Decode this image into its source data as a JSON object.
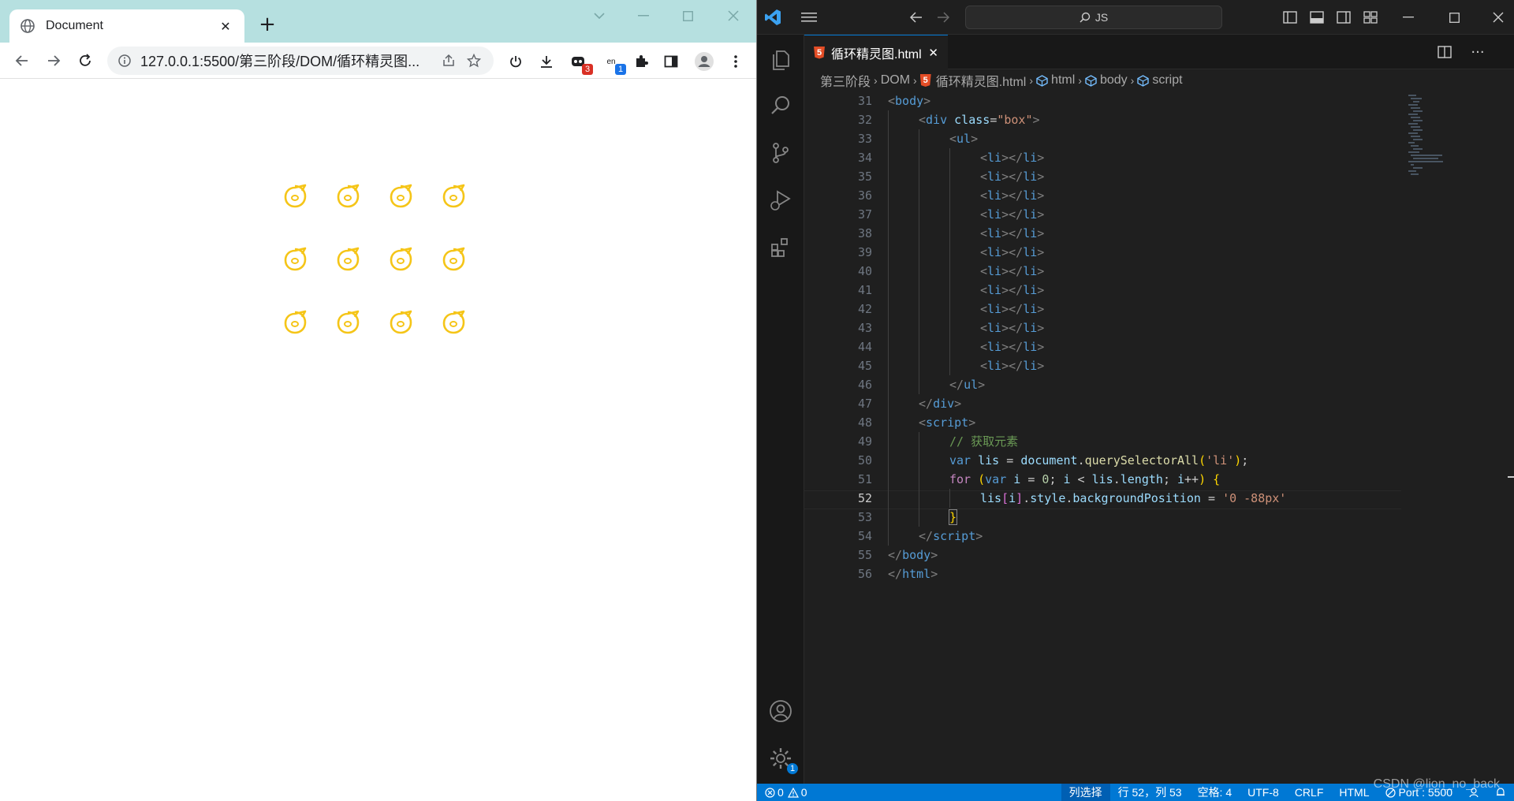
{
  "browser": {
    "tab": {
      "title": "Document"
    },
    "address": {
      "url": "127.0.0.1:5500/第三阶段/DOM/循环精灵图..."
    },
    "extensions": [
      {
        "name": "power-icon",
        "badge": ""
      },
      {
        "name": "download-icon",
        "badge": ""
      },
      {
        "name": "devtools-extension-icon",
        "badge": "3",
        "badge_color": "#d93025"
      },
      {
        "name": "translate-extension-icon",
        "badge": "1",
        "badge_color": "#1a73e8",
        "label": "en"
      },
      {
        "name": "puzzle-icon",
        "badge": ""
      },
      {
        "name": "side-panel-icon",
        "badge": ""
      },
      {
        "name": "profile-avatar-icon",
        "badge": ""
      },
      {
        "name": "kebab-menu-icon",
        "badge": ""
      }
    ],
    "sprites": {
      "rows": 3,
      "cols": 4,
      "color": "#f5c518"
    }
  },
  "vscode": {
    "search": {
      "text": "JS"
    },
    "editor_tab": {
      "filename": "循环精灵图.html"
    },
    "breadcrumb": [
      {
        "label": "第三阶段",
        "icon": ""
      },
      {
        "label": "DOM",
        "icon": ""
      },
      {
        "label": "循环精灵图.html",
        "icon": "html5"
      },
      {
        "label": "html",
        "icon": "cube"
      },
      {
        "label": "body",
        "icon": "cube"
      },
      {
        "label": "script",
        "icon": "cube"
      }
    ],
    "active_line": 52,
    "lines": [
      {
        "n": 31,
        "indent": 0,
        "html": "<span class=\"punct\">&lt;</span><span class=\"tag\">body</span><span class=\"punct\">&gt;</span>"
      },
      {
        "n": 32,
        "indent": 1,
        "html": "<span class=\"punct\">&lt;</span><span class=\"tag\">div</span> <span class=\"attr\">class</span>=<span class=\"str\">\"box\"</span><span class=\"punct\">&gt;</span>"
      },
      {
        "n": 33,
        "indent": 2,
        "html": "<span class=\"punct\">&lt;</span><span class=\"tag\">ul</span><span class=\"punct\">&gt;</span>"
      },
      {
        "n": 34,
        "indent": 3,
        "html": "<span class=\"punct\">&lt;</span><span class=\"tag\">li</span><span class=\"punct\">&gt;&lt;/</span><span class=\"tag\">li</span><span class=\"punct\">&gt;</span>"
      },
      {
        "n": 35,
        "indent": 3,
        "html": "<span class=\"punct\">&lt;</span><span class=\"tag\">li</span><span class=\"punct\">&gt;&lt;/</span><span class=\"tag\">li</span><span class=\"punct\">&gt;</span>"
      },
      {
        "n": 36,
        "indent": 3,
        "html": "<span class=\"punct\">&lt;</span><span class=\"tag\">li</span><span class=\"punct\">&gt;&lt;/</span><span class=\"tag\">li</span><span class=\"punct\">&gt;</span>"
      },
      {
        "n": 37,
        "indent": 3,
        "html": "<span class=\"punct\">&lt;</span><span class=\"tag\">li</span><span class=\"punct\">&gt;&lt;/</span><span class=\"tag\">li</span><span class=\"punct\">&gt;</span>"
      },
      {
        "n": 38,
        "indent": 3,
        "html": "<span class=\"punct\">&lt;</span><span class=\"tag\">li</span><span class=\"punct\">&gt;&lt;/</span><span class=\"tag\">li</span><span class=\"punct\">&gt;</span>"
      },
      {
        "n": 39,
        "indent": 3,
        "html": "<span class=\"punct\">&lt;</span><span class=\"tag\">li</span><span class=\"punct\">&gt;&lt;/</span><span class=\"tag\">li</span><span class=\"punct\">&gt;</span>"
      },
      {
        "n": 40,
        "indent": 3,
        "html": "<span class=\"punct\">&lt;</span><span class=\"tag\">li</span><span class=\"punct\">&gt;&lt;/</span><span class=\"tag\">li</span><span class=\"punct\">&gt;</span>"
      },
      {
        "n": 41,
        "indent": 3,
        "html": "<span class=\"punct\">&lt;</span><span class=\"tag\">li</span><span class=\"punct\">&gt;&lt;/</span><span class=\"tag\">li</span><span class=\"punct\">&gt;</span>"
      },
      {
        "n": 42,
        "indent": 3,
        "html": "<span class=\"punct\">&lt;</span><span class=\"tag\">li</span><span class=\"punct\">&gt;&lt;/</span><span class=\"tag\">li</span><span class=\"punct\">&gt;</span>"
      },
      {
        "n": 43,
        "indent": 3,
        "html": "<span class=\"punct\">&lt;</span><span class=\"tag\">li</span><span class=\"punct\">&gt;&lt;/</span><span class=\"tag\">li</span><span class=\"punct\">&gt;</span>"
      },
      {
        "n": 44,
        "indent": 3,
        "html": "<span class=\"punct\">&lt;</span><span class=\"tag\">li</span><span class=\"punct\">&gt;&lt;/</span><span class=\"tag\">li</span><span class=\"punct\">&gt;</span>"
      },
      {
        "n": 45,
        "indent": 3,
        "html": "<span class=\"punct\">&lt;</span><span class=\"tag\">li</span><span class=\"punct\">&gt;&lt;/</span><span class=\"tag\">li</span><span class=\"punct\">&gt;</span>"
      },
      {
        "n": 46,
        "indent": 2,
        "html": "<span class=\"punct\">&lt;/</span><span class=\"tag\">ul</span><span class=\"punct\">&gt;</span>"
      },
      {
        "n": 47,
        "indent": 1,
        "html": "<span class=\"punct\">&lt;/</span><span class=\"tag\">div</span><span class=\"punct\">&gt;</span>"
      },
      {
        "n": 48,
        "indent": 1,
        "html": "<span class=\"punct\">&lt;</span><span class=\"tag\">script</span><span class=\"punct\">&gt;</span>"
      },
      {
        "n": 49,
        "indent": 2,
        "html": "<span class=\"cmt\">// 获取元素</span>"
      },
      {
        "n": 50,
        "indent": 2,
        "html": "<span class=\"kw\">var</span> <span class=\"var\">lis</span> = <span class=\"var\">document</span>.<span class=\"fn\">querySelectorAll</span><span class=\"br1\">(</span><span class=\"str\">'li'</span><span class=\"br1\">)</span>;"
      },
      {
        "n": 51,
        "indent": 2,
        "html": "<span class=\"ctrl\">for</span> <span class=\"br1\">(</span><span class=\"kw\">var</span> <span class=\"var\">i</span> = <span class=\"num\">0</span>; <span class=\"var\">i</span> &lt; <span class=\"var\">lis</span>.<span class=\"var\">length</span>; <span class=\"var\">i</span>++<span class=\"br1\">)</span> <span class=\"br1\">{</span>"
      },
      {
        "n": 52,
        "indent": 3,
        "html": "<span class=\"var\">lis</span><span class=\"br2\">[</span><span class=\"var\">i</span><span class=\"br2\">]</span>.<span class=\"var\">style</span>.<span class=\"var\">backgroundPosition</span> = <span class=\"str\">'0 -88px'</span>"
      },
      {
        "n": 53,
        "indent": 2,
        "html": "<span class=\"br1\" style=\"outline:1px solid #888;\">}</span>"
      },
      {
        "n": 54,
        "indent": 1,
        "html": "<span class=\"punct\">&lt;/</span><span class=\"tag\">script</span><span class=\"punct\">&gt;</span>"
      },
      {
        "n": 55,
        "indent": 0,
        "html": "<span class=\"punct\">&lt;/</span><span class=\"tag\">body</span><span class=\"punct\">&gt;</span>"
      },
      {
        "n": 56,
        "indent": 0,
        "html": "<span class=\"punct\">&lt;/</span><span class=\"tag\">html</span><span class=\"punct\">&gt;</span>"
      }
    ],
    "accounts_badge": "1",
    "status": {
      "errors": "0",
      "warnings": "0",
      "selection_mode": "列选择",
      "position": "行 52，列 53",
      "spaces": "空格: 4",
      "encoding": "UTF-8",
      "eol": "CRLF",
      "language": "HTML",
      "port": "Port : 5500"
    },
    "watermark": "CSDN @lion_no_back"
  },
  "colors": {
    "vscode_accent": "#0078d4",
    "browser_titlebar": "#b6e0e0",
    "sprite": "#f5c518"
  }
}
